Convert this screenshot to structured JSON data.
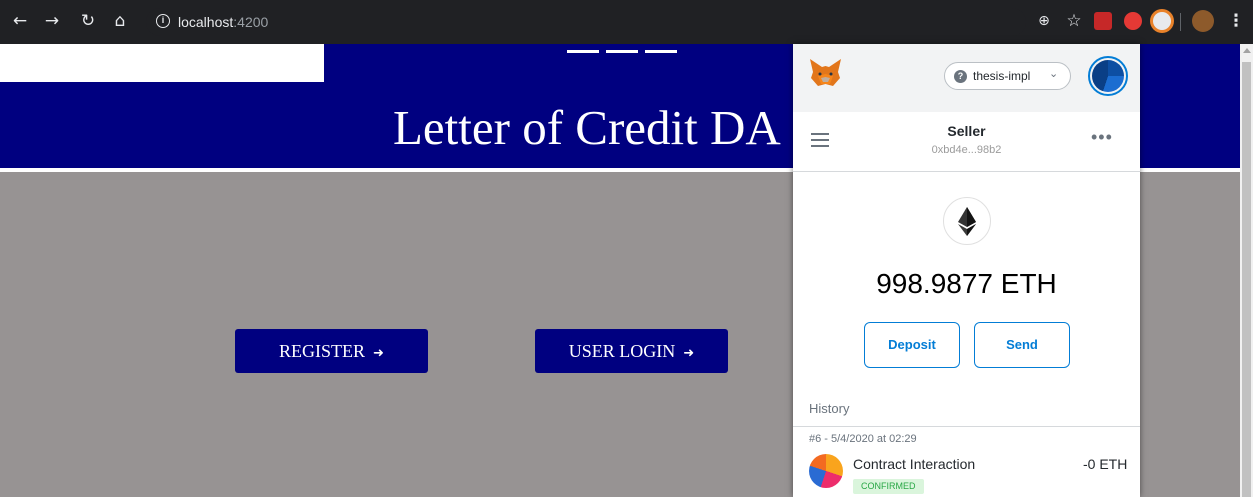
{
  "browser": {
    "url_host": "localhost",
    "url_port": ":4200"
  },
  "page": {
    "title": "Letter of Credit DA",
    "register_label": "REGISTER",
    "login_label": "USER LOGIN"
  },
  "metamask": {
    "network": "thesis-impl",
    "account_name": "Seller",
    "account_address": "0xbd4e...98b2",
    "balance": "998.9877 ETH",
    "deposit_label": "Deposit",
    "send_label": "Send",
    "history_label": "History",
    "transactions": [
      {
        "date": "#6 - 5/4/2020 at 02:29",
        "title": "Contract Interaction",
        "amount": "-0 ETH",
        "status": "CONFIRMED"
      }
    ]
  },
  "colors": {
    "brand_navy": "#000080",
    "page_gray": "#979393",
    "metamask_blue": "#037dd6",
    "confirmed_green": "#28a745"
  },
  "icons": [
    "back-arrow-icon",
    "forward-arrow-icon",
    "reload-icon",
    "home-icon",
    "info-icon",
    "zoom-icon",
    "star-icon",
    "pdf-extension-icon",
    "adblock-extension-icon",
    "metamask-extension-icon",
    "circle-extension-icon",
    "profile-avatar-icon",
    "kebab-menu-icon",
    "metamask-fox-icon",
    "help-icon",
    "chevron-down-icon",
    "account-identicon",
    "hamburger-icon",
    "more-dots-icon",
    "ethereum-icon",
    "sign-in-icon",
    "transaction-identicon"
  ]
}
